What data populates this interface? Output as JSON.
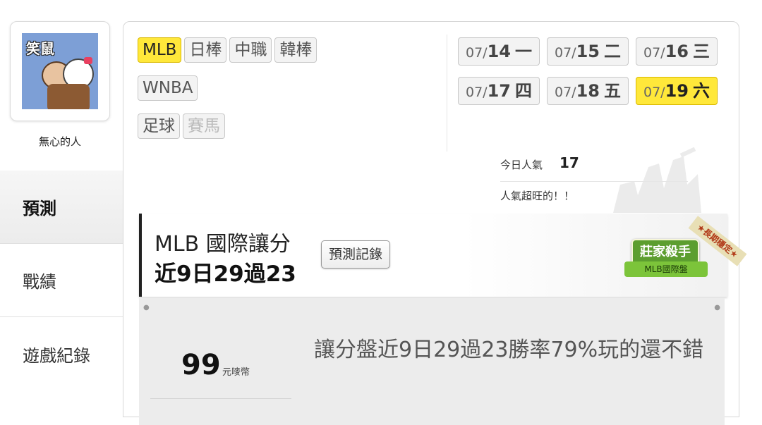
{
  "user": {
    "avatar_caption": "笑鼠",
    "name": "無心的人"
  },
  "menu": [
    {
      "label": "預測",
      "active": true
    },
    {
      "label": "戰績",
      "active": false
    },
    {
      "label": "遊戲紀錄",
      "active": false
    }
  ],
  "leagues": {
    "row1": [
      {
        "label": "MLB",
        "active": true
      },
      {
        "label": "日棒",
        "active": false
      },
      {
        "label": "中職",
        "active": false
      },
      {
        "label": "韓棒",
        "active": false
      }
    ],
    "row2": [
      {
        "label": "WNBA",
        "active": false
      }
    ],
    "row3": [
      {
        "label": "足球",
        "active": false
      },
      {
        "label": "賽馬",
        "active": false,
        "disabled": true
      }
    ]
  },
  "dates": [
    {
      "prefix": "07/",
      "day": "14",
      "weekday": "一",
      "active": false
    },
    {
      "prefix": "07/",
      "day": "15",
      "weekday": "二",
      "active": false
    },
    {
      "prefix": "07/",
      "day": "16",
      "weekday": "三",
      "active": false
    },
    {
      "prefix": "07/",
      "day": "17",
      "weekday": "四",
      "active": false
    },
    {
      "prefix": "07/",
      "day": "18",
      "weekday": "五",
      "active": false
    },
    {
      "prefix": "07/",
      "day": "19",
      "weekday": "六",
      "active": true
    }
  ],
  "popularity": {
    "label": "今日人氣",
    "value": "17",
    "note": "人氣超旺的！！"
  },
  "record": {
    "title": "MLB 國際讓分",
    "summary": "近9日29過23",
    "history_button": "預測記錄",
    "badge_main": "莊家殺手",
    "badge_sub": "MLB國際盤",
    "badge_ribbon": "★長期穩定★"
  },
  "price": {
    "amount": "99",
    "unit": "元嘜幣"
  },
  "description": "讓分盤近9日29過23勝率79%玩的還不錯",
  "colors": {
    "active_tag": "#ffe83a",
    "record_border": "#222222",
    "info_bg": "#ececec"
  }
}
